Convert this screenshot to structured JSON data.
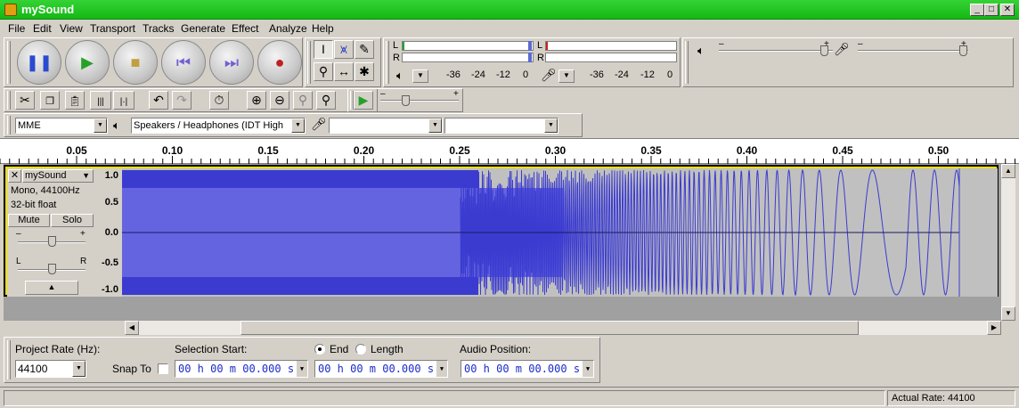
{
  "window": {
    "title": "mySound"
  },
  "menu": [
    "File",
    "Edit",
    "View",
    "Transport",
    "Tracks",
    "Generate",
    "Effect",
    "Analyze",
    "Help"
  ],
  "transport": {
    "buttons": [
      {
        "name": "pause",
        "icon": "pause-icon",
        "glyph": "❚❚",
        "color": "#2a4ad0"
      },
      {
        "name": "play",
        "icon": "play-icon",
        "glyph": "▶",
        "color": "#28a028"
      },
      {
        "name": "stop",
        "icon": "stop-icon",
        "glyph": "■",
        "color": "#c0a040"
      },
      {
        "name": "skip-start",
        "icon": "skip-to-start-icon",
        "glyph": "⏮",
        "color": "#7060d0"
      },
      {
        "name": "skip-end",
        "icon": "skip-to-end-icon",
        "glyph": "⏭",
        "color": "#7060d0"
      },
      {
        "name": "record",
        "icon": "record-icon",
        "glyph": "●",
        "color": "#c02020"
      }
    ]
  },
  "meters": {
    "playback": {
      "left_label": "L",
      "right_label": "R",
      "scale": [
        "-36",
        "-24",
        "-12",
        "0"
      ]
    },
    "record": {
      "left_label": "L",
      "right_label": "R",
      "scale": [
        "-36",
        "-24",
        "-12",
        "0"
      ]
    }
  },
  "devices": {
    "host": "MME",
    "output": "Speakers / Headphones (IDT High",
    "input": "",
    "channels": ""
  },
  "ruler": {
    "labels": [
      "0.05",
      "0.10",
      "0.15",
      "0.20",
      "0.25",
      "0.30",
      "0.35",
      "0.40",
      "0.45",
      "0.50"
    ]
  },
  "track": {
    "name": "mySound",
    "info1": "Mono, 44100Hz",
    "info2": "32-bit float",
    "mute": "Mute",
    "solo": "Solo",
    "gain_minus": "–",
    "gain_plus": "+",
    "pan_left": "L",
    "pan_right": "R",
    "y_labels": [
      "1.0",
      "0.5",
      "0.0",
      "-0.5",
      "-1.0"
    ]
  },
  "selection": {
    "project_rate_label": "Project Rate (Hz):",
    "project_rate": "44100",
    "snap_to": "Snap To",
    "selection_start_label": "Selection Start:",
    "end_label": "End",
    "length_label": "Length",
    "audio_position_label": "Audio Position:",
    "start_time": "00 h 00 m 00.000 s",
    "end_time": "00 h 00 m 00.000 s",
    "audio_position": "00 h 00 m 00.000 s"
  },
  "status": {
    "actual_rate": "Actual Rate: 44100"
  },
  "colors": {
    "wave": "#3b3bd0",
    "wave_rms": "#6464e0",
    "titlebar": "#1ec41e"
  }
}
